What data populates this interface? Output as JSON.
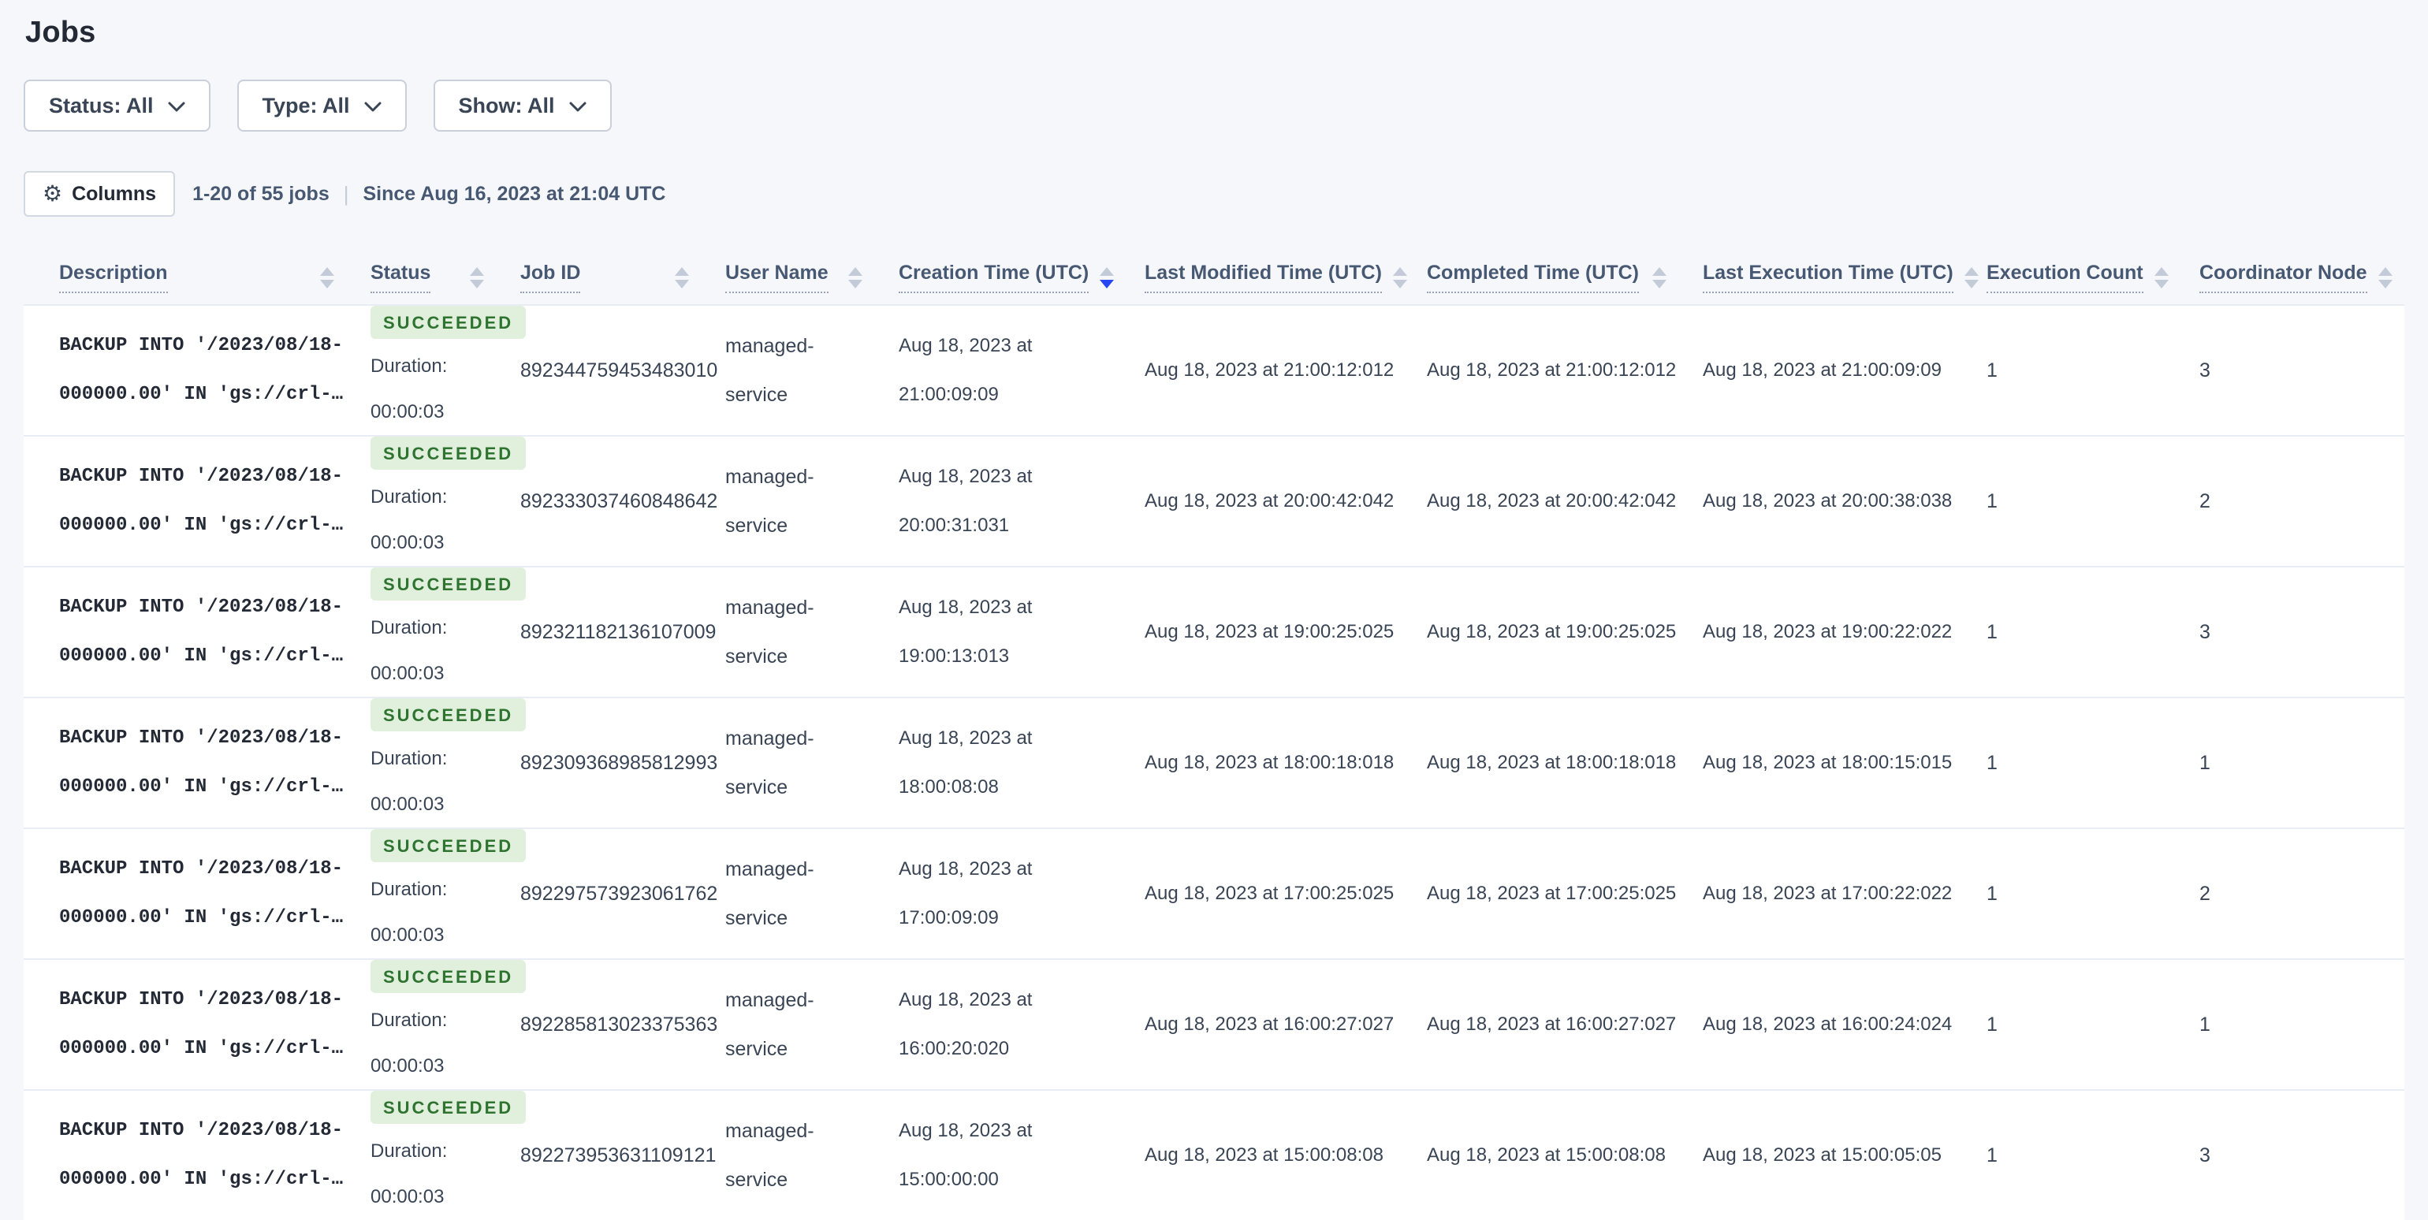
{
  "page": {
    "title": "Jobs",
    "background": "#f5f7fa"
  },
  "filters": {
    "items": [
      {
        "label": "Status: All"
      },
      {
        "label": "Type: All"
      },
      {
        "label": "Show: All"
      }
    ]
  },
  "toolbar": {
    "columns_label": "Columns",
    "jobs_count": "1-20 of 55 jobs",
    "divider": "|",
    "since": "Since Aug 16, 2023 at 21:04 UTC"
  },
  "icons": {
    "gear": "⚙",
    "chevron_down": "chevron-down",
    "sort": "up-down-triangles"
  },
  "colors": {
    "accent_blue": "#2847f2",
    "badge_bg": "#e1f0dd",
    "badge_text": "#2e732f",
    "header_text": "#475872",
    "body_text": "#394455",
    "row_border": "#e8edf3",
    "page_bg": "#f5f7fa"
  },
  "table": {
    "columns": [
      {
        "label": "Description",
        "sort": "none"
      },
      {
        "label": "Status",
        "sort": "none"
      },
      {
        "label": "Job ID",
        "sort": "none"
      },
      {
        "label": "User Name",
        "sort": "none"
      },
      {
        "label": "Creation Time (UTC)",
        "sort": "desc"
      },
      {
        "label": "Last Modified Time (UTC)",
        "sort": "none"
      },
      {
        "label": "Completed Time (UTC)",
        "sort": "none"
      },
      {
        "label": "Last Execution Time (UTC)",
        "sort": "none"
      },
      {
        "label": "Execution Count",
        "sort": "none"
      },
      {
        "label": "Coordinator Node",
        "sort": "none"
      }
    ],
    "rows": [
      {
        "description_line1": "BACKUP INTO '/2023/08/18-",
        "description_line2": "000000.00' IN 'gs://crl-…",
        "status": "SUCCEEDED",
        "duration_label": "Duration:",
        "duration": "00:00:03",
        "job_id": "892344759453483010",
        "user_name": "managed-service",
        "creation_time": "Aug 18, 2023 at 21:00:09:09",
        "last_modified_time": "Aug 18, 2023 at 21:00:12:012",
        "completed_time": "Aug 18, 2023 at 21:00:12:012",
        "last_execution_time": "Aug 18, 2023 at 21:00:09:09",
        "execution_count": "1",
        "coordinator_node": "3"
      },
      {
        "description_line1": "BACKUP INTO '/2023/08/18-",
        "description_line2": "000000.00' IN 'gs://crl-…",
        "status": "SUCCEEDED",
        "duration_label": "Duration:",
        "duration": "00:00:03",
        "job_id": "892333037460848642",
        "user_name": "managed-service",
        "creation_time": "Aug 18, 2023 at 20:00:31:031",
        "last_modified_time": "Aug 18, 2023 at 20:00:42:042",
        "completed_time": "Aug 18, 2023 at 20:00:42:042",
        "last_execution_time": "Aug 18, 2023 at 20:00:38:038",
        "execution_count": "1",
        "coordinator_node": "2"
      },
      {
        "description_line1": "BACKUP INTO '/2023/08/18-",
        "description_line2": "000000.00' IN 'gs://crl-…",
        "status": "SUCCEEDED",
        "duration_label": "Duration:",
        "duration": "00:00:03",
        "job_id": "892321182136107009",
        "user_name": "managed-service",
        "creation_time": "Aug 18, 2023 at 19:00:13:013",
        "last_modified_time": "Aug 18, 2023 at 19:00:25:025",
        "completed_time": "Aug 18, 2023 at 19:00:25:025",
        "last_execution_time": "Aug 18, 2023 at 19:00:22:022",
        "execution_count": "1",
        "coordinator_node": "3"
      },
      {
        "description_line1": "BACKUP INTO '/2023/08/18-",
        "description_line2": "000000.00' IN 'gs://crl-…",
        "status": "SUCCEEDED",
        "duration_label": "Duration:",
        "duration": "00:00:03",
        "job_id": "892309368985812993",
        "user_name": "managed-service",
        "creation_time": "Aug 18, 2023 at 18:00:08:08",
        "last_modified_time": "Aug 18, 2023 at 18:00:18:018",
        "completed_time": "Aug 18, 2023 at 18:00:18:018",
        "last_execution_time": "Aug 18, 2023 at 18:00:15:015",
        "execution_count": "1",
        "coordinator_node": "1"
      },
      {
        "description_line1": "BACKUP INTO '/2023/08/18-",
        "description_line2": "000000.00' IN 'gs://crl-…",
        "status": "SUCCEEDED",
        "duration_label": "Duration:",
        "duration": "00:00:03",
        "job_id": "892297573923061762",
        "user_name": "managed-service",
        "creation_time": "Aug 18, 2023 at 17:00:09:09",
        "last_modified_time": "Aug 18, 2023 at 17:00:25:025",
        "completed_time": "Aug 18, 2023 at 17:00:25:025",
        "last_execution_time": "Aug 18, 2023 at 17:00:22:022",
        "execution_count": "1",
        "coordinator_node": "2"
      },
      {
        "description_line1": "BACKUP INTO '/2023/08/18-",
        "description_line2": "000000.00' IN 'gs://crl-…",
        "status": "SUCCEEDED",
        "duration_label": "Duration:",
        "duration": "00:00:03",
        "job_id": "892285813023375363",
        "user_name": "managed-service",
        "creation_time": "Aug 18, 2023 at 16:00:20:020",
        "last_modified_time": "Aug 18, 2023 at 16:00:27:027",
        "completed_time": "Aug 18, 2023 at 16:00:27:027",
        "last_execution_time": "Aug 18, 2023 at 16:00:24:024",
        "execution_count": "1",
        "coordinator_node": "1"
      },
      {
        "description_line1": "BACKUP INTO '/2023/08/18-",
        "description_line2": "000000.00' IN 'gs://crl-…",
        "status": "SUCCEEDED",
        "duration_label": "Duration:",
        "duration": "00:00:03",
        "job_id": "892273953631109121",
        "user_name": "managed-service",
        "creation_time": "Aug 18, 2023 at 15:00:00:00",
        "last_modified_time": "Aug 18, 2023 at 15:00:08:08",
        "completed_time": "Aug 18, 2023 at 15:00:08:08",
        "last_execution_time": "Aug 18, 2023 at 15:00:05:05",
        "execution_count": "1",
        "coordinator_node": "3"
      }
    ]
  }
}
